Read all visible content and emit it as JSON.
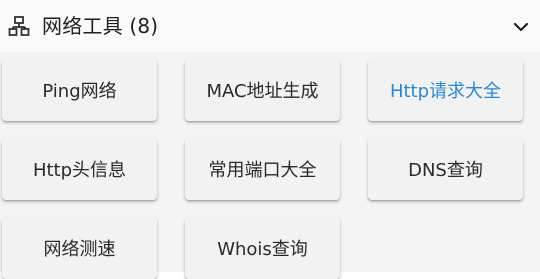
{
  "section": {
    "title": "网络工具 (8)",
    "icon": "network-icon",
    "toggle_icon": "chevron-down-icon"
  },
  "tools": [
    {
      "label": "Ping网络",
      "name": "tool-ping",
      "highlight": false
    },
    {
      "label": "MAC地址生成",
      "name": "tool-mac-address-generator",
      "highlight": false
    },
    {
      "label": "Http请求大全",
      "name": "tool-http-requests",
      "highlight": true
    },
    {
      "label": "Http头信息",
      "name": "tool-http-headers",
      "highlight": false
    },
    {
      "label": "常用端口大全",
      "name": "tool-common-ports",
      "highlight": false
    },
    {
      "label": "DNS查询",
      "name": "tool-dns-lookup",
      "highlight": false
    },
    {
      "label": "网络测速",
      "name": "tool-speed-test",
      "highlight": false
    },
    {
      "label": "Whois查询",
      "name": "tool-whois-lookup",
      "highlight": false
    }
  ],
  "colors": {
    "highlight_text": "#2d86cf",
    "button_bg": "#f2f2f2",
    "panel_bg": "#f4f4f4"
  }
}
